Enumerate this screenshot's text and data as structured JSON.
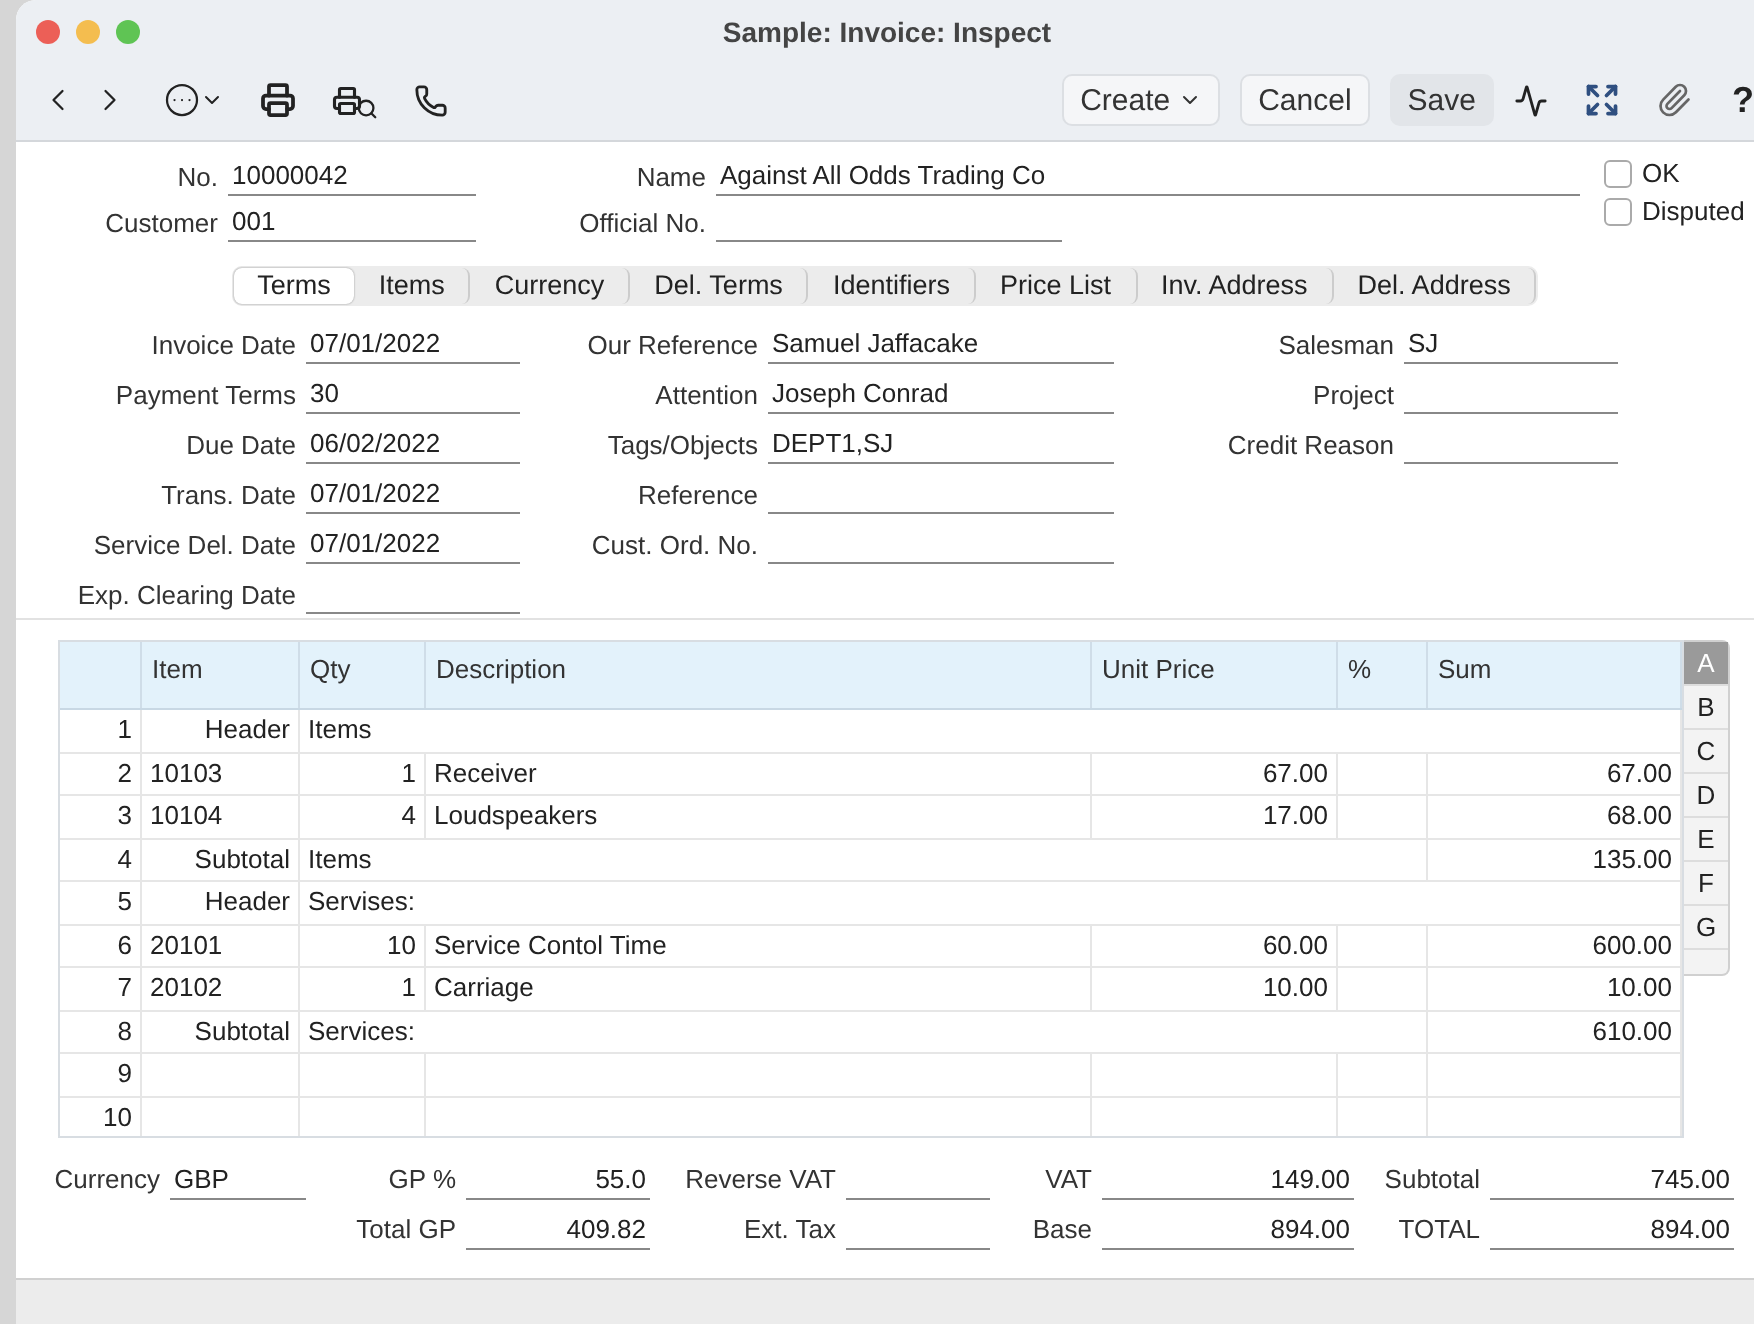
{
  "window": {
    "title": "Sample: Invoice: Inspect"
  },
  "toolbar": {
    "create": "Create",
    "cancel": "Cancel",
    "save": "Save",
    "help": "?"
  },
  "header_fields": [
    [
      {
        "label": "No.",
        "value": "10000042"
      },
      {
        "label": "Customer",
        "value": "001"
      }
    ],
    [
      {
        "label": "Name",
        "value": "Against All Odds Trading Co"
      },
      {
        "label": "Official No."
      }
    ]
  ],
  "flags": [
    {
      "label": "OK",
      "checked": false
    },
    {
      "label": "Disputed",
      "checked": false
    }
  ],
  "tabs": [
    {
      "label": "Terms",
      "selected": true
    },
    {
      "label": "Items",
      "selected": false
    },
    {
      "label": "Currency",
      "selected": false
    },
    {
      "label": "Del. Terms",
      "selected": false
    },
    {
      "label": "Identifiers",
      "selected": false
    },
    {
      "label": "Price List",
      "selected": false
    },
    {
      "label": "Inv. Address",
      "selected": false
    },
    {
      "label": "Del. Address",
      "selected": false
    }
  ],
  "fields": [
    [
      {
        "label": "Invoice Date",
        "value": "07/01/2022"
      },
      {
        "label": "Payment Terms",
        "value": "30"
      },
      {
        "label": "Due Date",
        "value": "06/02/2022"
      },
      {
        "label": "Trans. Date",
        "value": "07/01/2022"
      },
      {
        "label": "Service Del. Date",
        "value": "07/01/2022"
      },
      {
        "label": "Exp. Clearing Date"
      }
    ],
    [
      {
        "label": "Our Reference",
        "value": "Samuel Jaffacake"
      },
      {
        "label": "Attention",
        "value": "Joseph Conrad"
      },
      {
        "label": "Tags/Objects",
        "value": "DEPT1,SJ"
      },
      {
        "label": "Reference"
      },
      {
        "label": "Cust. Ord. No."
      }
    ],
    [
      {
        "label": "Salesman",
        "value": "SJ"
      },
      {
        "label": "Project"
      },
      {
        "label": "Credit Reason"
      }
    ]
  ],
  "table": {
    "columns": [
      "Item",
      "Qty",
      "Description",
      "Unit Price",
      "%",
      "Sum"
    ],
    "rows": [
      {
        "no": "1",
        "kind": "header",
        "item": "Header",
        "description": "Items"
      },
      {
        "no": "2",
        "kind": "line",
        "item": "10103",
        "qty": "1",
        "description": "Receiver",
        "unit_price": "67.00",
        "sum": "67.00"
      },
      {
        "no": "3",
        "kind": "line",
        "item": "10104",
        "qty": "4",
        "description": "Loudspeakers",
        "unit_price": "17.00",
        "sum": "68.00"
      },
      {
        "no": "4",
        "kind": "subtotal",
        "item": "Subtotal",
        "description": "Items",
        "sum": "135.00"
      },
      {
        "no": "5",
        "kind": "header",
        "item": "Header",
        "description": "Servises:"
      },
      {
        "no": "6",
        "kind": "line",
        "item": "20101",
        "qty": "10",
        "description": "Service Contol Time",
        "unit_price": "60.00",
        "sum": "600.00"
      },
      {
        "no": "7",
        "kind": "line",
        "item": "20102",
        "qty": "1",
        "description": "Carriage",
        "unit_price": "10.00",
        "sum": "10.00"
      },
      {
        "no": "8",
        "kind": "subtotal",
        "item": "Subtotal",
        "description": "Services:",
        "sum": "610.00"
      },
      {
        "no": "9",
        "kind": "line"
      },
      {
        "no": "10",
        "kind": "line"
      }
    ],
    "index_tabs": [
      {
        "label": "A",
        "selected": true
      },
      {
        "label": "B",
        "selected": false
      },
      {
        "label": "C",
        "selected": false
      },
      {
        "label": "D",
        "selected": false
      },
      {
        "label": "E",
        "selected": false
      },
      {
        "label": "F",
        "selected": false
      },
      {
        "label": "G",
        "selected": false
      }
    ]
  },
  "totals": [
    {
      "top": {
        "label": "Currency",
        "value": "GBP"
      }
    },
    {
      "top": {
        "label": "GP %",
        "value": "55.0"
      },
      "bottom": {
        "label": "Total GP",
        "value": "409.82"
      }
    },
    {
      "top": {
        "label": "Reverse VAT"
      },
      "bottom": {
        "label": "Ext. Tax"
      }
    },
    {
      "top": {
        "label": "VAT",
        "value": "149.00"
      },
      "bottom": {
        "label": "Base",
        "value": "894.00"
      }
    },
    {
      "top": {
        "label": "Subtotal",
        "value": "745.00"
      },
      "bottom": {
        "label": "TOTAL",
        "value": "894.00"
      }
    }
  ]
}
